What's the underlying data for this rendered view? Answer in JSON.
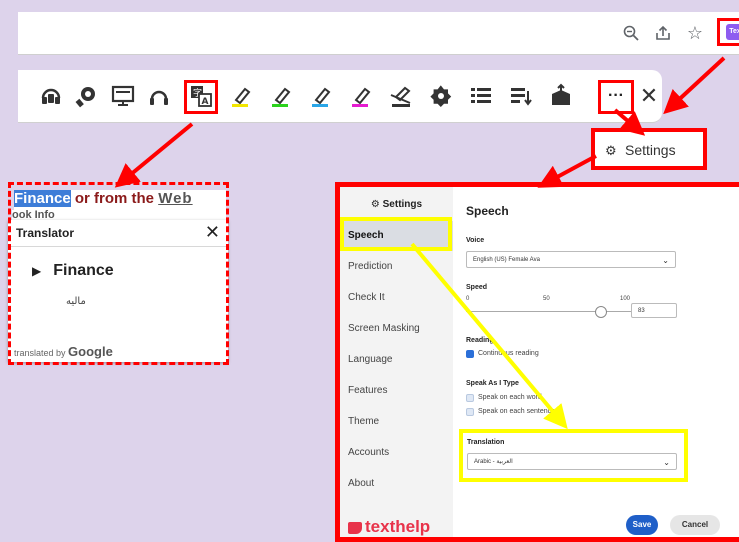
{
  "extension": {
    "badge": "Tex"
  },
  "translator": {
    "page_word": "Finance",
    "page_rest": " or from the ",
    "page_link": "Web Store",
    "page_sub": "ook Info",
    "title": "Translator",
    "close": "✕",
    "word": "Finance",
    "translation": "ماليه",
    "credit_prefix": "translated by ",
    "credit_brand": "Google"
  },
  "settings_menu": {
    "label": "Settings"
  },
  "dialog": {
    "sidebar_title": "Settings",
    "sidebar_items": [
      "Speech",
      "Prediction",
      "Check It",
      "Screen Masking",
      "Language",
      "Features",
      "Theme",
      "Accounts",
      "About"
    ],
    "section_title": "Speech",
    "voice_label": "Voice",
    "voice_value": "English (US) Female Ava",
    "speed_label": "Speed",
    "speed_ticks": [
      "0",
      "50",
      "100"
    ],
    "speed_value": "83",
    "reading_label": "Reading",
    "continuous_reading": "Continuous reading",
    "speak_as_type_label": "Speak As I Type",
    "speak_each_word": "Speak on each word",
    "speak_each_sentence": "Speak on each sentence",
    "translation_label": "Translation",
    "translation_value": "Arabic - العربية",
    "save_label": "Save",
    "cancel_label": "Cancel",
    "logo": "texthelp"
  },
  "colors": {
    "highlight_red": "#ff0000",
    "highlight_yellow": "#ffff00",
    "primary": "#1f5fc8",
    "brand": "#e8334a"
  }
}
